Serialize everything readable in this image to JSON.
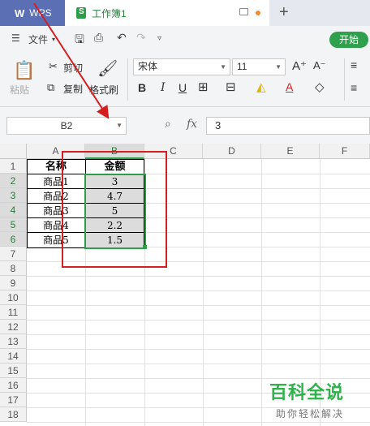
{
  "titlebar": {
    "app_tab": "WPS",
    "doc_tab": "工作簿1",
    "new_tab_icon": "plus-icon"
  },
  "menu": {
    "file_label": "文件",
    "start_label": "开始"
  },
  "ribbon": {
    "paste_label": "粘贴",
    "cut_label": "剪切",
    "copy_label": "复制",
    "format_painter_label": "格式刷",
    "font_name": "宋体",
    "font_size": "11",
    "bold": "B",
    "italic": "I",
    "underline": "U"
  },
  "formula_bar": {
    "name_box": "B2",
    "fx_label": "fx",
    "formula_value": "3"
  },
  "grid": {
    "columns": [
      "A",
      "B",
      "C",
      "D",
      "E",
      "F"
    ],
    "rows": [
      "1",
      "2",
      "3",
      "4",
      "5",
      "6",
      "7",
      "8",
      "9",
      "10",
      "11",
      "12",
      "13",
      "14",
      "15",
      "16",
      "17",
      "18"
    ],
    "active_column": "B",
    "active_rows": [
      "2",
      "3",
      "4",
      "5",
      "6"
    ],
    "cells": {
      "A1": "名称",
      "B1": "金额",
      "A2": "商品1",
      "B2": "3",
      "A3": "商品2",
      "B3": "4.7",
      "A4": "商品3",
      "B4": "5",
      "A5": "商品4",
      "B5": "2.2",
      "A6": "商品5",
      "B6": "1.5"
    }
  },
  "watermark": {
    "title": "百科全说",
    "subtitle": "助你轻松解决"
  },
  "colors": {
    "accent_green": "#2e9d48",
    "annotation_red": "#d31f1f",
    "wps_blue": "#5b6fb4"
  }
}
